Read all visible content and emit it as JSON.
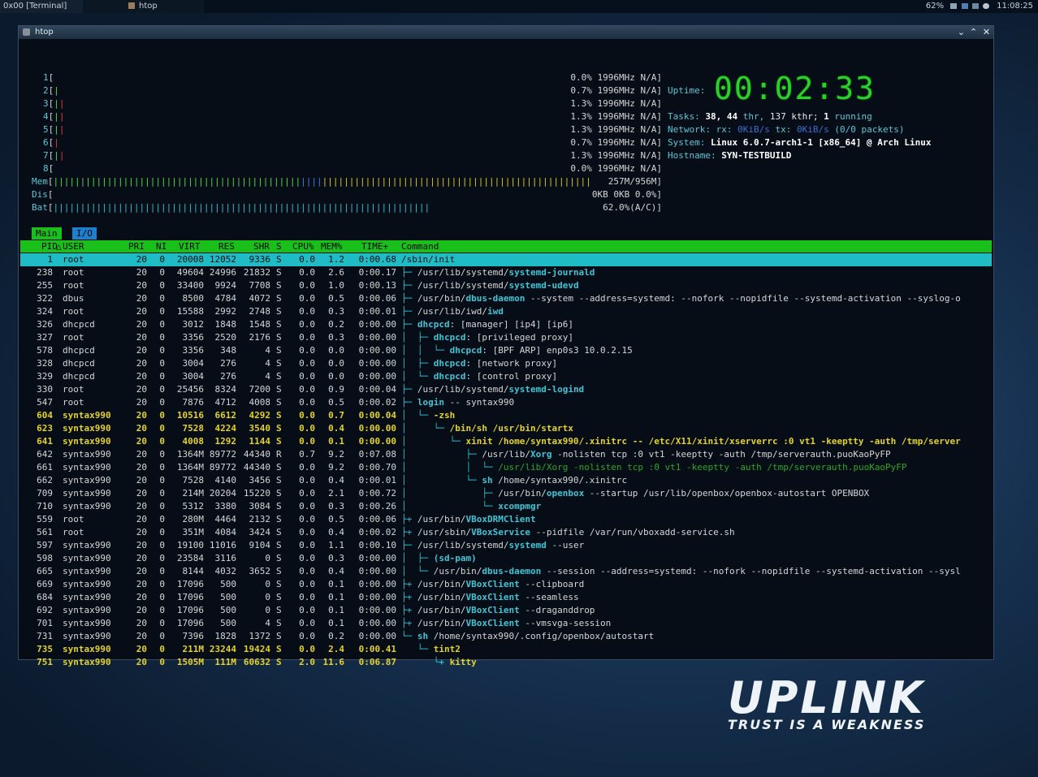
{
  "topbar": {
    "tasks": [
      {
        "label": "0x00 [Terminal]"
      },
      {
        "label": "htop"
      }
    ],
    "battery": "62%",
    "time": "11:08:25"
  },
  "window": {
    "title": "htop"
  },
  "meters": {
    "cpus": [
      {
        "num": "1",
        "bar": {
          "g": "",
          "r": ""
        },
        "value": "0.0% 1996MHz N/A]"
      },
      {
        "num": "2",
        "bar": {
          "g": "|",
          "r": ""
        },
        "value": "0.7% 1996MHz N/A]"
      },
      {
        "num": "3",
        "bar": {
          "g": "|",
          "r": "|"
        },
        "value": "1.3% 1996MHz N/A]"
      },
      {
        "num": "4",
        "bar": {
          "g": "|",
          "r": "|"
        },
        "value": "1.3% 1996MHz N/A]"
      },
      {
        "num": "5",
        "bar": {
          "g": "|",
          "r": "|"
        },
        "value": "1.3% 1996MHz N/A]"
      },
      {
        "num": "6",
        "bar": {
          "g": "",
          "r": "|"
        },
        "value": "0.7% 1996MHz N/A]"
      },
      {
        "num": "7",
        "bar": {
          "g": "|",
          "r": "|"
        },
        "value": "1.3% 1996MHz N/A]"
      },
      {
        "num": "8",
        "bar": {
          "g": "",
          "r": ""
        },
        "value": "0.0% 1996MHz N/A]"
      }
    ],
    "mem": {
      "label": "Mem",
      "green": "||||||||||||||||||||||||||||||||||||||||||||||",
      "blue": "||||",
      "yellow": "||||||||||||||||||||||||||||||||||||||||||||||||||",
      "value": "257M/956M]"
    },
    "dsk": {
      "label": "Dis",
      "value": "0KB 0KB 0.0%]"
    },
    "bat": {
      "label": "Bat",
      "bar": "||||||||||||||||||||||||||||||||||||||||||||||||||||||||||||||||||||||||||||||||||||||||||||||||||||||||||||||||||||||||||||||||",
      "value": "62.0%(A/C)]"
    }
  },
  "sysinfo": {
    "uptime_label": "Uptime:",
    "clock": "00:02:33",
    "tasks": {
      "label": "Tasks:",
      "count": "38,",
      "thr": "44",
      "thr_label": "thr,",
      "kthr": "137 kthr;",
      "running": "1",
      "running_label": "running"
    },
    "network": {
      "label": "Network:",
      "rx_label": "rx:",
      "rx": "0KiB/s",
      "tx_label": "tx:",
      "tx": "0KiB/s",
      "packets": "(0/0 packets)"
    },
    "system": {
      "label": "System:",
      "value": "Linux 6.0.7-arch1-1 [x86_64] @ Arch Linux"
    },
    "hostname": {
      "label": "Hostname:",
      "value": "SYN-TESTBUILD"
    }
  },
  "tabs": [
    {
      "label": "Main"
    },
    {
      "label": "I/O"
    }
  ],
  "columns": [
    "PID",
    "USER",
    "PRI",
    "NI",
    "VIRT",
    "RES",
    "SHR",
    "S",
    "CPU%",
    "MEM%",
    "TIME+",
    "Command"
  ],
  "processes": [
    {
      "pid": "1",
      "user": "root",
      "pri": "20",
      "ni": "0",
      "virt": "20008",
      "res": "12052",
      "shr": "9336",
      "s": "S",
      "cpu": "0.0",
      "mem": "1.2",
      "time": "0:00.68",
      "tree": "",
      "cmd_pre": "/sbin/init",
      "cmd_bin": "",
      "cmd_args": "",
      "style": "sel"
    },
    {
      "pid": "238",
      "user": "root",
      "pri": "20",
      "ni": "0",
      "virt": "49604",
      "res": "24996",
      "shr": "21832",
      "s": "S",
      "cpu": "0.0",
      "mem": "2.6",
      "time": "0:00.17",
      "tree": "├─ ",
      "cmd_pre": "/usr/lib/systemd/",
      "cmd_bin": "systemd-journald",
      "cmd_args": "",
      "style": ""
    },
    {
      "pid": "255",
      "user": "root",
      "pri": "20",
      "ni": "0",
      "virt": "33400",
      "res": "9924",
      "shr": "7708",
      "s": "S",
      "cpu": "0.0",
      "mem": "1.0",
      "time": "0:00.13",
      "tree": "├─ ",
      "cmd_pre": "/usr/lib/systemd/",
      "cmd_bin": "systemd-udevd",
      "cmd_args": "",
      "style": ""
    },
    {
      "pid": "322",
      "user": "dbus",
      "pri": "20",
      "ni": "0",
      "virt": "8500",
      "res": "4784",
      "shr": "4072",
      "s": "S",
      "cpu": "0.0",
      "mem": "0.5",
      "time": "0:00.06",
      "tree": "├─ ",
      "cmd_pre": "/usr/bin/",
      "cmd_bin": "dbus-daemon",
      "cmd_args": " --system --address=systemd: --nofork --nopidfile --systemd-activation --syslog-o",
      "style": ""
    },
    {
      "pid": "324",
      "user": "root",
      "pri": "20",
      "ni": "0",
      "virt": "15588",
      "res": "2992",
      "shr": "2748",
      "s": "S",
      "cpu": "0.0",
      "mem": "0.3",
      "time": "0:00.01",
      "tree": "├─ ",
      "cmd_pre": "/usr/lib/iwd/",
      "cmd_bin": "iwd",
      "cmd_args": "",
      "style": ""
    },
    {
      "pid": "326",
      "user": "dhcpcd",
      "pri": "20",
      "ni": "0",
      "virt": "3012",
      "res": "1848",
      "shr": "1548",
      "s": "S",
      "cpu": "0.0",
      "mem": "0.2",
      "time": "0:00.00",
      "tree": "├─ ",
      "cmd_pre": "",
      "cmd_bin": "dhcpcd",
      "cmd_args": ": [manager] [ip4] [ip6]",
      "style": ""
    },
    {
      "pid": "327",
      "user": "root",
      "pri": "20",
      "ni": "0",
      "virt": "3356",
      "res": "2520",
      "shr": "2176",
      "s": "S",
      "cpu": "0.0",
      "mem": "0.3",
      "time": "0:00.00",
      "tree": "│  ├─ ",
      "cmd_pre": "",
      "cmd_bin": "dhcpcd",
      "cmd_args": ": [privileged proxy]",
      "style": ""
    },
    {
      "pid": "578",
      "user": "dhcpcd",
      "pri": "20",
      "ni": "0",
      "virt": "3356",
      "res": "348",
      "shr": "4",
      "s": "S",
      "cpu": "0.0",
      "mem": "0.0",
      "time": "0:00.00",
      "tree": "│  │  └─ ",
      "cmd_pre": "",
      "cmd_bin": "dhcpcd",
      "cmd_args": ": [BPF ARP] enp0s3 10.0.2.15",
      "style": ""
    },
    {
      "pid": "328",
      "user": "dhcpcd",
      "pri": "20",
      "ni": "0",
      "virt": "3004",
      "res": "276",
      "shr": "4",
      "s": "S",
      "cpu": "0.0",
      "mem": "0.0",
      "time": "0:00.00",
      "tree": "│  ├─ ",
      "cmd_pre": "",
      "cmd_bin": "dhcpcd",
      "cmd_args": ": [network proxy]",
      "style": ""
    },
    {
      "pid": "329",
      "user": "dhcpcd",
      "pri": "20",
      "ni": "0",
      "virt": "3004",
      "res": "276",
      "shr": "4",
      "s": "S",
      "cpu": "0.0",
      "mem": "0.0",
      "time": "0:00.00",
      "tree": "│  └─ ",
      "cmd_pre": "",
      "cmd_bin": "dhcpcd",
      "cmd_args": ": [control proxy]",
      "style": ""
    },
    {
      "pid": "330",
      "user": "root",
      "pri": "20",
      "ni": "0",
      "virt": "25456",
      "res": "8324",
      "shr": "7200",
      "s": "S",
      "cpu": "0.0",
      "mem": "0.9",
      "time": "0:00.04",
      "tree": "├─ ",
      "cmd_pre": "/usr/lib/systemd/",
      "cmd_bin": "systemd-logind",
      "cmd_args": "",
      "style": ""
    },
    {
      "pid": "547",
      "user": "root",
      "pri": "20",
      "ni": "0",
      "virt": "7876",
      "res": "4712",
      "shr": "4008",
      "s": "S",
      "cpu": "0.0",
      "mem": "0.5",
      "time": "0:00.02",
      "tree": "├─ ",
      "cmd_pre": "",
      "cmd_bin": "login",
      "cmd_args": " -- syntax990",
      "style": ""
    },
    {
      "pid": "604",
      "user": "syntax990",
      "pri": "20",
      "ni": "0",
      "virt": "10516",
      "res": "6612",
      "shr": "4292",
      "s": "S",
      "cpu": "0.0",
      "mem": "0.7",
      "time": "0:00.04",
      "tree": "│  └─ ",
      "cmd_pre": "",
      "cmd_bin": "-zsh",
      "cmd_args": "",
      "style": "hl"
    },
    {
      "pid": "623",
      "user": "syntax990",
      "pri": "20",
      "ni": "0",
      "virt": "7528",
      "res": "4224",
      "shr": "3540",
      "s": "S",
      "cpu": "0.0",
      "mem": "0.4",
      "time": "0:00.00",
      "tree": "│     └─ ",
      "cmd_pre": "/bin/sh /usr/bin/startx",
      "cmd_bin": "",
      "cmd_args": "",
      "style": "hl"
    },
    {
      "pid": "641",
      "user": "syntax990",
      "pri": "20",
      "ni": "0",
      "virt": "4008",
      "res": "1292",
      "shr": "1144",
      "s": "S",
      "cpu": "0.0",
      "mem": "0.1",
      "time": "0:00.00",
      "tree": "│        └─ ",
      "cmd_pre": "xinit /home/syntax990/.xinitrc -- /etc/X11/xinit/xserverrc :0 vt1 -keeptty -auth /tmp/server",
      "cmd_bin": "",
      "cmd_args": "",
      "style": "hl"
    },
    {
      "pid": "642",
      "user": "syntax990",
      "pri": "20",
      "ni": "0",
      "virt": "1364M",
      "res": "89772",
      "shr": "44340",
      "s": "R",
      "cpu": "0.7",
      "mem": "9.2",
      "time": "0:07.08",
      "tree": "│           ├─ ",
      "cmd_pre": "/usr/lib/",
      "cmd_bin": "Xorg",
      "cmd_args": " -nolisten tcp :0 vt1 -keeptty -auth /tmp/serverauth.puoKaoPyFP",
      "style": ""
    },
    {
      "pid": "661",
      "user": "syntax990",
      "pri": "20",
      "ni": "0",
      "virt": "1364M",
      "res": "89772",
      "shr": "44340",
      "s": "S",
      "cpu": "0.0",
      "mem": "9.2",
      "time": "0:00.70",
      "tree": "│           │  └─ ",
      "cmd_pre": "/usr/lib/",
      "cmd_bin": "Xorg",
      "cmd_args": " -nolisten tcp :0 vt1 -keeptty -auth /tmp/serverauth.puoKaoPyFP",
      "style": "dimrow"
    },
    {
      "pid": "662",
      "user": "syntax990",
      "pri": "20",
      "ni": "0",
      "virt": "7528",
      "res": "4140",
      "shr": "3456",
      "s": "S",
      "cpu": "0.0",
      "mem": "0.4",
      "time": "0:00.01",
      "tree": "│           └─ ",
      "cmd_pre": "",
      "cmd_bin": "sh",
      "cmd_args": " /home/syntax990/.xinitrc",
      "style": ""
    },
    {
      "pid": "709",
      "user": "syntax990",
      "pri": "20",
      "ni": "0",
      "virt": "214M",
      "res": "20204",
      "shr": "15220",
      "s": "S",
      "cpu": "0.0",
      "mem": "2.1",
      "time": "0:00.72",
      "tree": "│              ├─ ",
      "cmd_pre": "/usr/bin/",
      "cmd_bin": "openbox",
      "cmd_args": " --startup /usr/lib/openbox/openbox-autostart OPENBOX",
      "style": ""
    },
    {
      "pid": "710",
      "user": "syntax990",
      "pri": "20",
      "ni": "0",
      "virt": "5312",
      "res": "3380",
      "shr": "3084",
      "s": "S",
      "cpu": "0.0",
      "mem": "0.3",
      "time": "0:00.26",
      "tree": "│              └─ ",
      "cmd_pre": "",
      "cmd_bin": "xcompmgr",
      "cmd_args": "",
      "style": ""
    },
    {
      "pid": "559",
      "user": "root",
      "pri": "20",
      "ni": "0",
      "virt": "280M",
      "res": "4464",
      "shr": "2132",
      "s": "S",
      "cpu": "0.0",
      "mem": "0.5",
      "time": "0:00.06",
      "tree": "├+ ",
      "cmd_pre": "/usr/bin/",
      "cmd_bin": "VBoxDRMClient",
      "cmd_args": "",
      "style": ""
    },
    {
      "pid": "561",
      "user": "root",
      "pri": "20",
      "ni": "0",
      "virt": "351M",
      "res": "4084",
      "shr": "3424",
      "s": "S",
      "cpu": "0.0",
      "mem": "0.4",
      "time": "0:00.02",
      "tree": "├+ ",
      "cmd_pre": "/usr/sbin/",
      "cmd_bin": "VBoxService",
      "cmd_args": " --pidfile /var/run/vboxadd-service.sh",
      "style": ""
    },
    {
      "pid": "597",
      "user": "syntax990",
      "pri": "20",
      "ni": "0",
      "virt": "19100",
      "res": "11016",
      "shr": "9104",
      "s": "S",
      "cpu": "0.0",
      "mem": "1.1",
      "time": "0:00.10",
      "tree": "├─ ",
      "cmd_pre": "/usr/lib/systemd/",
      "cmd_bin": "systemd",
      "cmd_args": " --user",
      "style": ""
    },
    {
      "pid": "598",
      "user": "syntax990",
      "pri": "20",
      "ni": "0",
      "virt": "23584",
      "res": "3116",
      "shr": "0",
      "s": "S",
      "cpu": "0.0",
      "mem": "0.3",
      "time": "0:00.00",
      "tree": "│  ├─ ",
      "cmd_pre": "",
      "cmd_bin": "(sd-pam)",
      "cmd_args": "",
      "style": ""
    },
    {
      "pid": "665",
      "user": "syntax990",
      "pri": "20",
      "ni": "0",
      "virt": "8144",
      "res": "4032",
      "shr": "3652",
      "s": "S",
      "cpu": "0.0",
      "mem": "0.4",
      "time": "0:00.00",
      "tree": "│  └─ ",
      "cmd_pre": "/usr/bin/",
      "cmd_bin": "dbus-daemon",
      "cmd_args": " --session --address=systemd: --nofork --nopidfile --systemd-activation --sysl",
      "style": ""
    },
    {
      "pid": "669",
      "user": "syntax990",
      "pri": "20",
      "ni": "0",
      "virt": "17096",
      "res": "500",
      "shr": "0",
      "s": "S",
      "cpu": "0.0",
      "mem": "0.1",
      "time": "0:00.00",
      "tree": "├+ ",
      "cmd_pre": "/usr/bin/",
      "cmd_bin": "VBoxClient",
      "cmd_args": " --clipboard",
      "style": ""
    },
    {
      "pid": "684",
      "user": "syntax990",
      "pri": "20",
      "ni": "0",
      "virt": "17096",
      "res": "500",
      "shr": "0",
      "s": "S",
      "cpu": "0.0",
      "mem": "0.1",
      "time": "0:00.00",
      "tree": "├+ ",
      "cmd_pre": "/usr/bin/",
      "cmd_bin": "VBoxClient",
      "cmd_args": " --seamless",
      "style": ""
    },
    {
      "pid": "692",
      "user": "syntax990",
      "pri": "20",
      "ni": "0",
      "virt": "17096",
      "res": "500",
      "shr": "0",
      "s": "S",
      "cpu": "0.0",
      "mem": "0.1",
      "time": "0:00.00",
      "tree": "├+ ",
      "cmd_pre": "/usr/bin/",
      "cmd_bin": "VBoxClient",
      "cmd_args": " --draganddrop",
      "style": ""
    },
    {
      "pid": "701",
      "user": "syntax990",
      "pri": "20",
      "ni": "0",
      "virt": "17096",
      "res": "500",
      "shr": "4",
      "s": "S",
      "cpu": "0.0",
      "mem": "0.1",
      "time": "0:00.00",
      "tree": "├+ ",
      "cmd_pre": "/usr/bin/",
      "cmd_bin": "VBoxClient",
      "cmd_args": " --vmsvga-session",
      "style": ""
    },
    {
      "pid": "731",
      "user": "syntax990",
      "pri": "20",
      "ni": "0",
      "virt": "7396",
      "res": "1828",
      "shr": "1372",
      "s": "S",
      "cpu": "0.0",
      "mem": "0.2",
      "time": "0:00.00",
      "tree": "└─ ",
      "cmd_pre": "",
      "cmd_bin": "sh",
      "cmd_args": " /home/syntax990/.config/openbox/autostart",
      "style": ""
    },
    {
      "pid": "735",
      "user": "syntax990",
      "pri": "20",
      "ni": "0",
      "virt": "211M",
      "res": "23244",
      "shr": "19424",
      "s": "S",
      "cpu": "0.0",
      "mem": "2.4",
      "time": "0:00.41",
      "tree": "   └─ ",
      "cmd_pre": "tint2",
      "cmd_bin": "",
      "cmd_args": "",
      "style": "hl"
    },
    {
      "pid": "751",
      "user": "syntax990",
      "pri": "20",
      "ni": "0",
      "virt": "1505M",
      "res": "111M",
      "shr": "60632",
      "s": "S",
      "cpu": "2.0",
      "mem": "11.6",
      "time": "0:06.87",
      "tree": "      └+ ",
      "cmd_pre": "kitty",
      "cmd_bin": "",
      "cmd_args": "",
      "style": "hl"
    }
  ],
  "wallpaper": {
    "logo": "UPLINK",
    "tagline": "TRUST IS A WEAKNESS"
  }
}
